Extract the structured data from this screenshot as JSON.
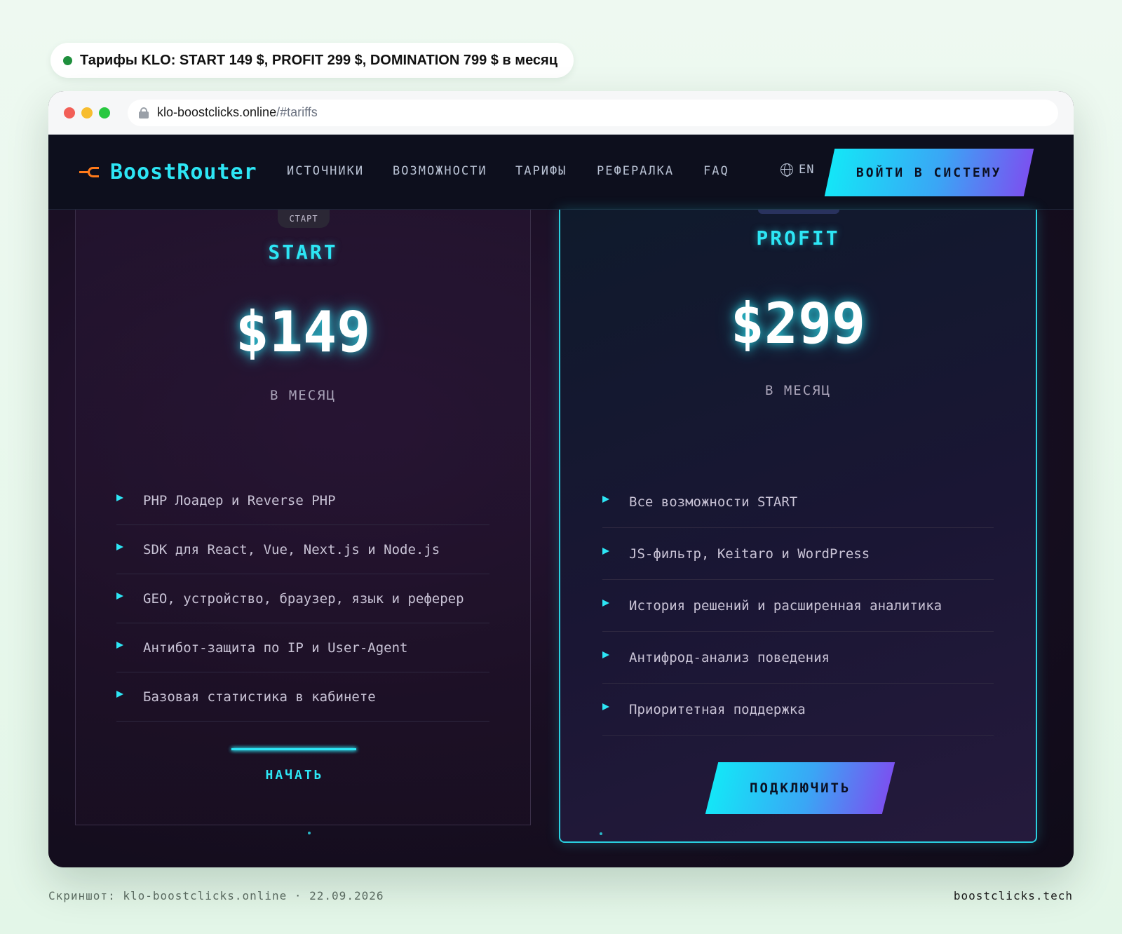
{
  "caption": {
    "text": "Тарифы KLO: START 149 $, PROFIT 299 $, DOMINATION 799 $ в месяц",
    "status_color": "#1f8f3d"
  },
  "browser": {
    "domain": "klo-boostclicks.online",
    "path": "/#tariffs"
  },
  "nav": {
    "brand": "BoostRouter",
    "links": [
      "ИСТОЧНИКИ",
      "ВОЗМОЖНОСТИ",
      "ТАРИФЫ",
      "РЕФЕРАЛКА",
      "FAQ"
    ],
    "lang": "EN",
    "login": "ВОЙТИ В СИСТЕМУ"
  },
  "plans": {
    "start": {
      "badge": "СТАРТ",
      "name": "START",
      "price": "$149",
      "period": "В МЕСЯЦ",
      "features": [
        "PHP Лоадер и Reverse PHP",
        "SDK для React, Vue, Next.js и Node.js",
        "GEO, устройство, браузер, язык и реферер",
        "Антибот-защита по IP и User-Agent",
        "Базовая статистика в кабинете"
      ],
      "cta": "НАЧАТЬ"
    },
    "profit": {
      "name": "PROFIT",
      "price": "$299",
      "period": "В МЕСЯЦ",
      "features": [
        "Все возможности START",
        "JS-фильтр, Keitaro и WordPress",
        "История решений и расширенная аналитика",
        "Антифрод-анализ поведения",
        "Приоритетная поддержка"
      ],
      "cta": "ПОДКЛЮЧИТЬ"
    }
  },
  "colors": {
    "accent": "#2de6f5",
    "brand_orange": "#ff7a1a",
    "gradient_end": "#7a52f0"
  },
  "footer": {
    "left": "Скриншот: klo-boostclicks.online · 22.09.2026",
    "right": "boostclicks.tech"
  }
}
